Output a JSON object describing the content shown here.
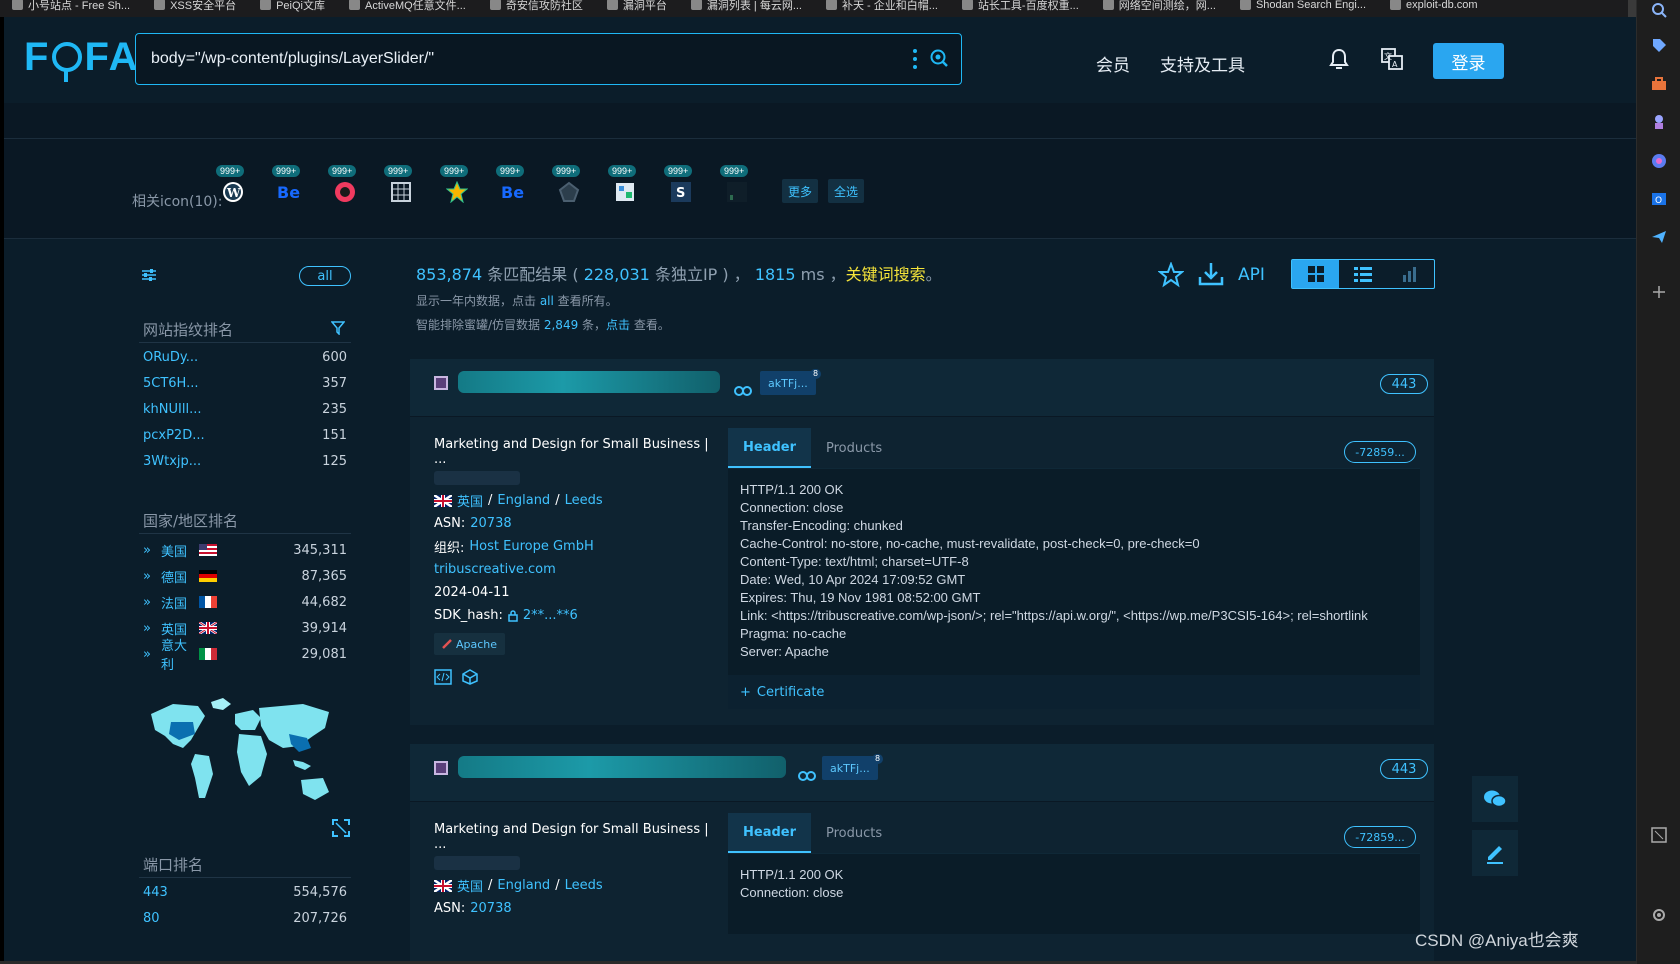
{
  "browser_tabs": [
    {
      "label": "小号站点 - Free Sh..."
    },
    {
      "label": "XSS安全平台"
    },
    {
      "label": "PeiQi文库"
    },
    {
      "label": "ActiveMQ任意文件..."
    },
    {
      "label": "奇安信攻防社区"
    },
    {
      "label": "漏洞平台"
    },
    {
      "label": "漏洞列表 | 每云网..."
    },
    {
      "label": "补天 - 企业和白帽..."
    },
    {
      "label": "站长工具-百度权重..."
    },
    {
      "label": "网络空间测绘，网..."
    },
    {
      "label": "Shodan Search Engi..."
    },
    {
      "label": "exploit-db.com"
    }
  ],
  "search": {
    "query": "body=\"/wp-content/plugins/LayerSlider/\""
  },
  "nav": {
    "member": "会员",
    "tools": "支持及工具",
    "login": "登录"
  },
  "related_icons": {
    "label": "相关icon(10):",
    "badge": "999+",
    "items": [
      "wordpress-icon",
      "behance-icon",
      "red-circle-icon",
      "grid-icon",
      "star-icon",
      "behance-icon",
      "pentagon-icon",
      "image-icon",
      "s-icon",
      "dark-icon"
    ],
    "more": "更多",
    "select_all": "全选"
  },
  "sidebar": {
    "all": "all",
    "fingerprint_title": "网站指纹排名",
    "fingerprints": [
      {
        "k": "ORuDy...",
        "v": "600"
      },
      {
        "k": "5CT6H...",
        "v": "357"
      },
      {
        "k": "khNUIll...",
        "v": "235"
      },
      {
        "k": "pcxP2D...",
        "v": "151"
      },
      {
        "k": "3Wtxjp...",
        "v": "125"
      }
    ],
    "country_title": "国家/地区排名",
    "countries": [
      {
        "k": "美国",
        "v": "345,311"
      },
      {
        "k": "德国",
        "v": "87,365"
      },
      {
        "k": "法国",
        "v": "44,682"
      },
      {
        "k": "英国",
        "v": "39,914"
      },
      {
        "k": "意大利",
        "v": "29,081"
      }
    ],
    "port_title": "端口排名",
    "ports": [
      {
        "k": "443",
        "v": "554,576"
      },
      {
        "k": "80",
        "v": "207,726"
      }
    ]
  },
  "summary": {
    "count": "853,874",
    "match_text": " 条匹配结果 ( ",
    "ip_count": "228,031",
    "ip_text": " 条独立IP ) ，",
    "ms": " 1815",
    "ms_text": " ms ，",
    "keyword": "关键词搜索",
    "period": "。",
    "line2_a": "显示一年内数据，点击 ",
    "line2_all": "all",
    "line2_b": " 查看所有。",
    "line3_a": "智能排除蜜罐/仿冒数据 ",
    "line3_num": "2,849",
    "line3_b": " 条，",
    "line3_click": "点击",
    "line3_c": " 查看。"
  },
  "toolbar": {
    "api": "API"
  },
  "cards": [
    {
      "tag": "akTFj...",
      "tag_sup": "8",
      "port": "443",
      "title": "Marketing and Design for Small Business | ...",
      "country": "英国",
      "region": "England",
      "city": "Leeds",
      "asn_label": "ASN:",
      "asn": "20738",
      "org_label": "组织:",
      "org": "Host Europe GmbH",
      "domain": "tribuscreative.com",
      "date": "2024-04-11",
      "sdk_label": "SDK_hash:",
      "sdk": "2**...**6",
      "server": "Apache",
      "tab_header": "Header",
      "tab_products": "Products",
      "hash": "-72859...",
      "header_lines": [
        "HTTP/1.1 200 OK",
        "Connection: close",
        "Transfer-Encoding: chunked",
        "Cache-Control: no-store, no-cache, must-revalidate, post-check=0, pre-check=0",
        "Content-Type: text/html; charset=UTF-8",
        "Date: Wed, 10 Apr 2024 17:09:52 GMT",
        "Expires: Thu, 19 Nov 1981 08:52:00 GMT",
        "Link: <https://tribuscreative.com/wp-json/>; rel=\"https://api.w.org/\", <https://wp.me/P3CSI5-164>; rel=shortlink",
        "Pragma: no-cache",
        "Server: Apache"
      ],
      "certificate": "Certificate"
    },
    {
      "tag": "akTFj...",
      "tag_sup": "8",
      "port": "443",
      "title": "Marketing and Design for Small Business | ...",
      "country": "英国",
      "region": "England",
      "city": "Leeds",
      "asn_label": "ASN:",
      "asn": "20738",
      "tab_header": "Header",
      "tab_products": "Products",
      "hash": "-72859...",
      "header_lines": [
        "HTTP/1.1 200 OK",
        "Connection: close"
      ]
    }
  ],
  "watermark": "CSDN @Aniya也会爽"
}
